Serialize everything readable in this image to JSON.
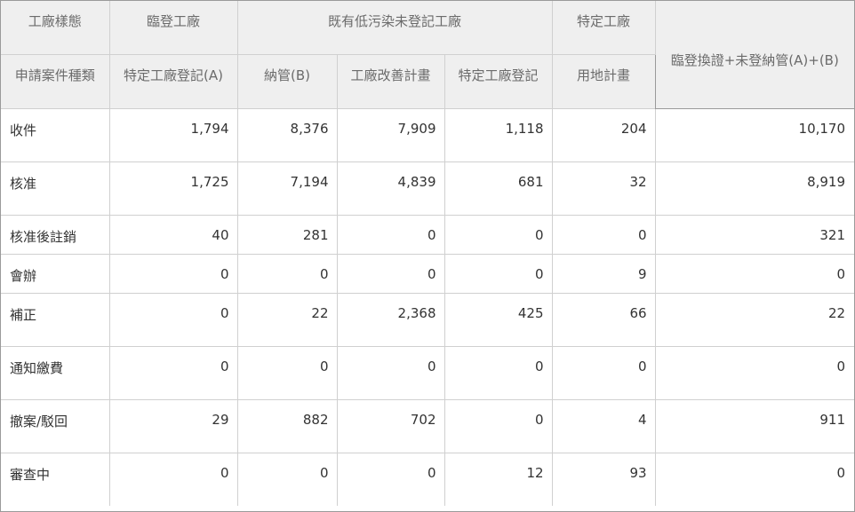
{
  "table": {
    "header_row1": {
      "factory_type": "工廠樣態",
      "temp_registered": "臨登工廠",
      "existing_low_pollution": "既有低污染未登記工廠",
      "specific_factory": "特定工廠",
      "total": "臨登換證+未登納管(A)+(B)"
    },
    "header_row2": {
      "case_type": "申請案件種類",
      "specific_registration_a": "特定工廠登記(A)",
      "inclusion_b": "納管(B)",
      "improvement_plan": "工廠改善計畫",
      "specific_registration": "特定工廠登記",
      "land_use_plan": "用地計畫"
    },
    "rows": [
      {
        "label": "收件",
        "values": [
          "1,794",
          "8,376",
          "7,909",
          "1,118",
          "204",
          "10,170"
        ]
      },
      {
        "label": "核准",
        "values": [
          "1,725",
          "7,194",
          "4,839",
          "681",
          "32",
          "8,919"
        ]
      },
      {
        "label": "核准後註銷",
        "values": [
          "40",
          "281",
          "0",
          "0",
          "0",
          "321"
        ]
      },
      {
        "label": "會辦",
        "values": [
          "0",
          "0",
          "0",
          "0",
          "9",
          "0"
        ]
      },
      {
        "label": "補正",
        "values": [
          "0",
          "22",
          "2,368",
          "425",
          "66",
          "22"
        ]
      },
      {
        "label": "通知繳費",
        "values": [
          "0",
          "0",
          "0",
          "0",
          "0",
          "0"
        ]
      },
      {
        "label": "撤案/駁回",
        "values": [
          "29",
          "882",
          "702",
          "0",
          "4",
          "911"
        ]
      },
      {
        "label": "審查中",
        "values": [
          "0",
          "0",
          "0",
          "12",
          "93",
          "0"
        ]
      }
    ]
  }
}
